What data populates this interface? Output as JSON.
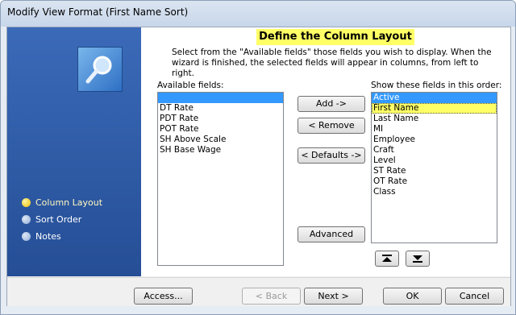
{
  "window": {
    "title": "Modify View Format (First Name Sort)"
  },
  "heading": "Define the Column Layout",
  "description": "Select from the \"Available fields\" those fields you wish to display. When the wizard is finished, the selected fields will appear in columns, from left to right.",
  "steps": [
    {
      "label": "Column Layout",
      "active": true
    },
    {
      "label": "Sort Order",
      "active": false
    },
    {
      "label": "Notes",
      "active": false
    }
  ],
  "available": {
    "label": "Available fields:",
    "items": [
      "",
      "DT Rate",
      "PDT Rate",
      "POT Rate",
      "SH Above Scale",
      "SH Base Wage"
    ]
  },
  "shown": {
    "label": "Show these fields in this order:",
    "items": [
      "Active",
      "First Name",
      "Last Name",
      "MI",
      "Employee",
      "Craft",
      "Level",
      "ST Rate",
      "OT Rate",
      "Class"
    ],
    "selected_index": 0,
    "highlighted_index": 1
  },
  "buttons": {
    "add": "Add ->",
    "remove": "< Remove",
    "defaults": "< Defaults ->",
    "advanced": "Advanced",
    "access": "Access...",
    "back": "< Back",
    "next": "Next >",
    "ok": "OK",
    "cancel": "Cancel"
  },
  "colors": {
    "highlight": "#ffff66",
    "selection": "#3399ff",
    "sidebar": "#2f5aa3"
  }
}
